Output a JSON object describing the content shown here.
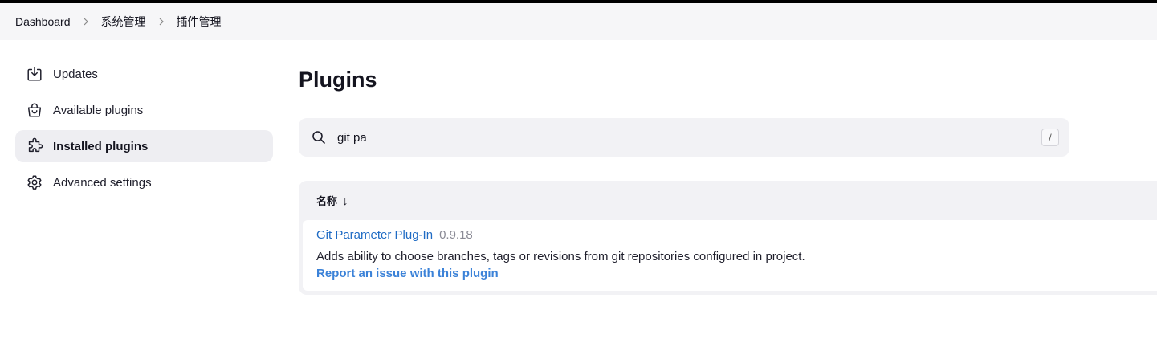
{
  "breadcrumb": {
    "items": [
      "Dashboard",
      "系统管理",
      "插件管理"
    ]
  },
  "sidebar": {
    "items": [
      {
        "label": "Updates",
        "icon": "download-icon"
      },
      {
        "label": "Available plugins",
        "icon": "shopping-bag-icon"
      },
      {
        "label": "Installed plugins",
        "icon": "puzzle-icon",
        "active": true
      },
      {
        "label": "Advanced settings",
        "icon": "gear-icon"
      }
    ]
  },
  "main": {
    "title": "Plugins",
    "search": {
      "value": "git pa",
      "shortcut": "/"
    },
    "table": {
      "header": {
        "name_label": "名称",
        "sort_indicator": "↓"
      },
      "rows": [
        {
          "name": "Git Parameter Plug-In",
          "version": "0.9.18",
          "description": "Adds ability to choose branches, tags or revisions from git repositories configured in project.",
          "issue_link": "Report an issue with this plugin"
        }
      ]
    }
  },
  "colors": {
    "link": "#1f6bc4",
    "issue_link": "#3b82d8",
    "active_bg": "#eeeef2"
  }
}
